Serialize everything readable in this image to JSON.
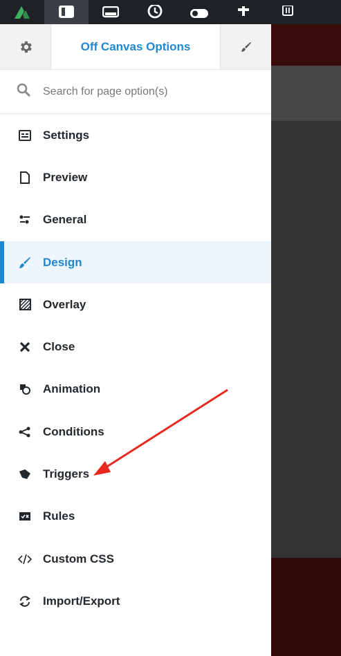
{
  "toolbar": {
    "items": [
      "logo-icon",
      "panel-icon",
      "layers-icon",
      "history-icon",
      "toggle-icon",
      "add-icon",
      "trash-icon"
    ],
    "active_index": 1
  },
  "panel": {
    "title": "Off Canvas Options",
    "search_placeholder": "Search for page option(s)",
    "menu": [
      {
        "label": "Settings",
        "icon": "settings-icon"
      },
      {
        "label": "Preview",
        "icon": "document-icon"
      },
      {
        "label": "General",
        "icon": "sliders-icon"
      },
      {
        "label": "Design",
        "icon": "brush-icon",
        "active": true
      },
      {
        "label": "Overlay",
        "icon": "hatch-icon"
      },
      {
        "label": "Close",
        "icon": "close-icon"
      },
      {
        "label": "Animation",
        "icon": "animation-icon"
      },
      {
        "label": "Conditions",
        "icon": "share-icon"
      },
      {
        "label": "Triggers",
        "icon": "pointer-icon"
      },
      {
        "label": "Rules",
        "icon": "rules-icon"
      },
      {
        "label": "Custom CSS",
        "icon": "code-icon"
      },
      {
        "label": "Import/Export",
        "icon": "sync-icon"
      }
    ]
  },
  "colors": {
    "accent": "#1e88d0",
    "annotation": "#e8281e",
    "toolbar_bg": "#1e2226",
    "logo": "#3fb15e"
  }
}
